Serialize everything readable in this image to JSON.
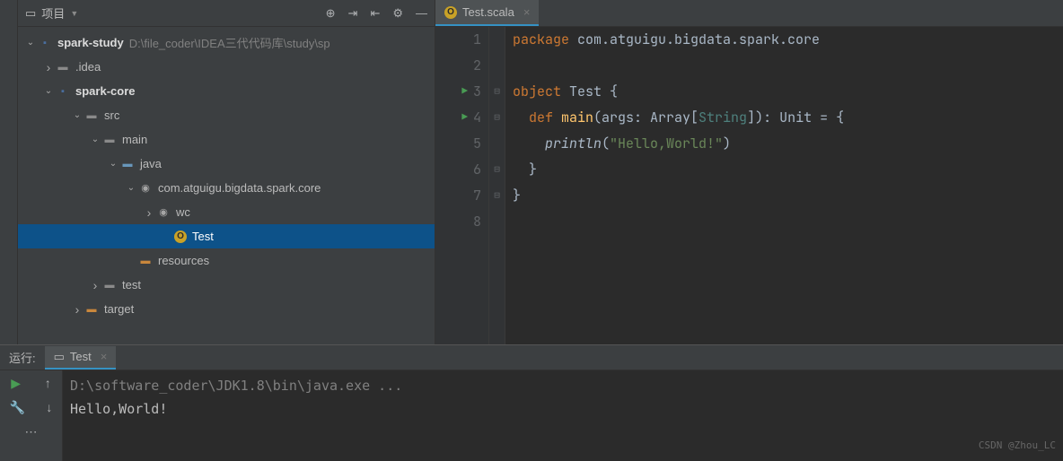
{
  "sidebar": {
    "title": "项目",
    "actions": {
      "target": "⊕",
      "expand": "⇥",
      "collapse": "⇤",
      "settings": "⚙",
      "minimize": "—"
    }
  },
  "tree": {
    "root": {
      "name": "spark-study",
      "path": "D:\\file_coder\\IDEA三代代码库\\study\\sp"
    },
    "idea": ".idea",
    "sparkcore": "spark-core",
    "src": "src",
    "main": "main",
    "java": "java",
    "pkg": "com.atguigu.bigdata.spark.core",
    "wc": "wc",
    "test_obj": "Test",
    "resources": "resources",
    "test": "test",
    "target": "target"
  },
  "editor": {
    "tab": "Test.scala",
    "lines": [
      "1",
      "2",
      "3",
      "4",
      "5",
      "6",
      "7",
      "8"
    ],
    "code": {
      "l1_kw": "package",
      "l1_pkg": " com.atguigu.bigdata.spark.core",
      "l3_kw": "object",
      "l3_name": " Test {",
      "l4_kw": "  def ",
      "l4_fn": "main",
      "l4_sig1": "(args: Array[",
      "l4_type": "String",
      "l4_sig2": "]): Unit = {",
      "l5_fn": "    println",
      "l5_paren1": "(",
      "l5_str": "\"Hello,World!\"",
      "l5_paren2": ")",
      "l6": "  }",
      "l7": "}"
    }
  },
  "run": {
    "label": "运行:",
    "tab": "Test",
    "cmd": "D:\\software_coder\\JDK1.8\\bin\\java.exe ...",
    "output": "Hello,World!"
  },
  "watermark": "CSDN @Zhou_LC"
}
